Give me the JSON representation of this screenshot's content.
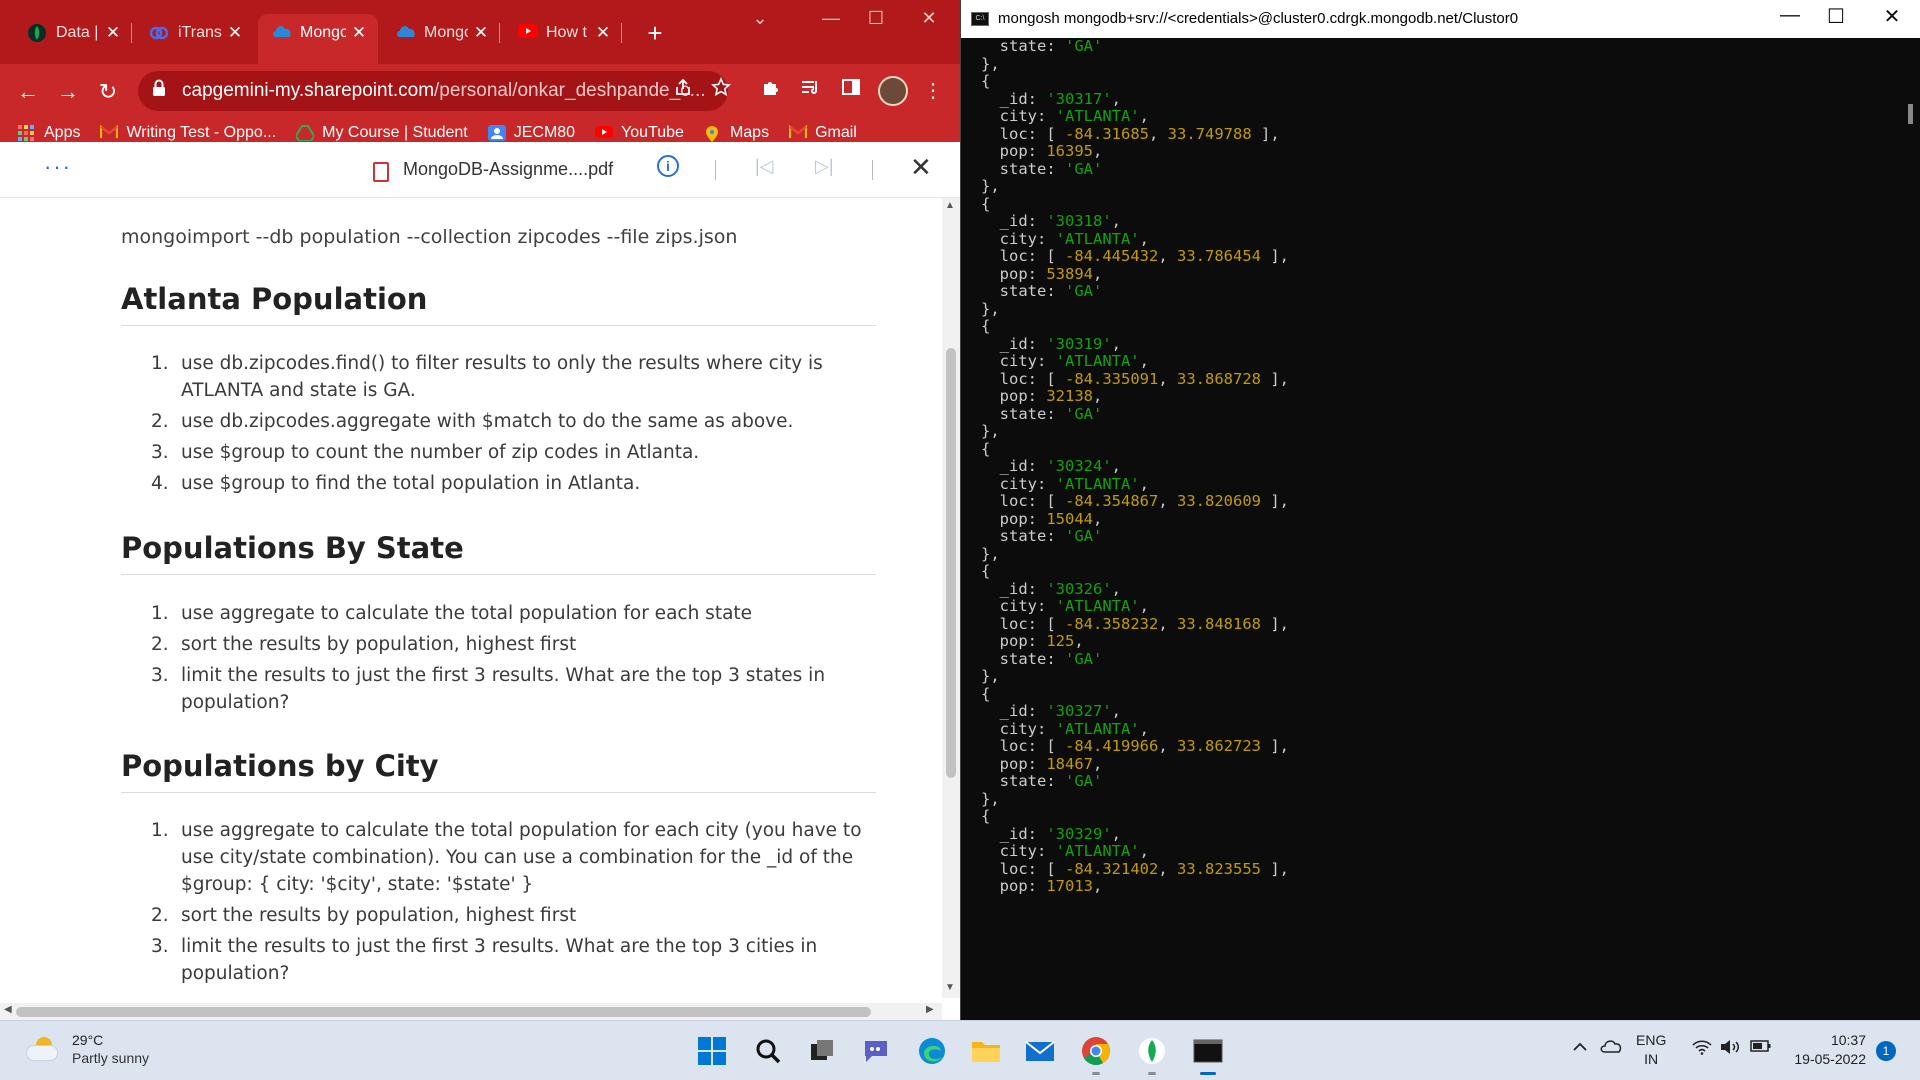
{
  "browser": {
    "tabs": [
      {
        "label": "Data |",
        "favicon_color": "#116149"
      },
      {
        "label": "iTransf",
        "favicon_color": "#3a5dd6"
      },
      {
        "label": "Mongo",
        "favicon_color": "#2b88d8"
      },
      {
        "label": "Mongo",
        "favicon_color": "#2b88d8"
      },
      {
        "label": "How t",
        "favicon_color": "#ff0000"
      }
    ],
    "active_tab_index": 2,
    "new_tab_label": "+",
    "window_controls": {
      "dropdown": "⌄",
      "minimize": "—",
      "maximize": "☐",
      "close": "✕"
    },
    "address": {
      "host": "capgemini-my.sharepoint.com",
      "path": "/personal/onkar_deshpande_c..."
    },
    "nav": {
      "back": "←",
      "forward": "→",
      "reload": "↻"
    },
    "bookmarks": [
      {
        "label": "Apps",
        "icon": "apps-grid-icon",
        "color": "#ffffff"
      },
      {
        "label": "Writing Test - Oppo...",
        "icon": "gmail-icon",
        "color": "#ea4335"
      },
      {
        "label": "My Course | Student",
        "icon": "drive-icon",
        "color": "#34a853"
      },
      {
        "label": "JECM80",
        "icon": "contact-icon",
        "color": "#4285f4"
      },
      {
        "label": "YouTube",
        "icon": "youtube-icon",
        "color": "#ff0000"
      },
      {
        "label": "Maps",
        "icon": "maps-icon",
        "color": "#fbbc04"
      },
      {
        "label": "Gmail",
        "icon": "gmail-icon",
        "color": "#ea4335"
      }
    ],
    "accent_color": "#c8282a"
  },
  "pdf": {
    "more_label": "···",
    "file_name": "MongoDB-Assignme....pdf",
    "info_label": "i",
    "first_page": "|◁",
    "last_page": "▷|",
    "close_label": "✕",
    "import_command": "mongoimport --db population --collection zipcodes --file zips.json",
    "sections": [
      {
        "title": "Atlanta Population",
        "items": [
          "use db.zipcodes.find() to filter results to only the results where city is ATLANTA and state is GA.",
          "use db.zipcodes.aggregate with $match to do the same as above.",
          "use $group to count the number of zip codes in Atlanta.",
          "use $group to find the total population in Atlanta."
        ]
      },
      {
        "title": "Populations By State",
        "items": [
          "use aggregate to calculate the total population for each state",
          "sort the results by population, highest first",
          "limit the results to just the first 3 results. What are the top 3 states in population?"
        ]
      },
      {
        "title": "Populations by City",
        "items": [
          "use aggregate to calculate the total population for each city (you have to use city/state combination). You can use a combination for the _id of the $group: { city: '$city', state: '$state' }",
          "sort the results by population, highest first",
          "limit the results to just the first 3 results. What are the top 3 cities in population?"
        ]
      }
    ]
  },
  "terminal": {
    "title": "mongosh mongodb+srv://<credentials>@cluster0.cdrgk.mongodb.net/Clustor0",
    "controls": {
      "minimize": "—",
      "maximize": "☐",
      "close": "✕"
    },
    "leading_state": "GA",
    "records": [
      {
        "_id": "30317",
        "city": "ATLANTA",
        "loc": [
          "-84.31685",
          "33.749788"
        ],
        "pop": "16395",
        "state": "GA"
      },
      {
        "_id": "30318",
        "city": "ATLANTA",
        "loc": [
          "-84.445432",
          "33.786454"
        ],
        "pop": "53894",
        "state": "GA"
      },
      {
        "_id": "30319",
        "city": "ATLANTA",
        "loc": [
          "-84.335091",
          "33.868728"
        ],
        "pop": "32138",
        "state": "GA"
      },
      {
        "_id": "30324",
        "city": "ATLANTA",
        "loc": [
          "-84.354867",
          "33.820609"
        ],
        "pop": "15044",
        "state": "GA"
      },
      {
        "_id": "30326",
        "city": "ATLANTA",
        "loc": [
          "-84.358232",
          "33.848168"
        ],
        "pop": "125",
        "state": "GA"
      },
      {
        "_id": "30327",
        "city": "ATLANTA",
        "loc": [
          "-84.419966",
          "33.862723"
        ],
        "pop": "18467",
        "state": "GA"
      },
      {
        "_id": "30329",
        "city": "ATLANTA",
        "loc": [
          "-84.321402",
          "33.823555"
        ],
        "pop": "17013",
        "state": ""
      }
    ]
  },
  "taskbar": {
    "weather": {
      "temp": "29°C",
      "desc": "Partly sunny"
    },
    "apps": [
      {
        "name": "start-button",
        "icon": "windows-icon"
      },
      {
        "name": "search-button",
        "icon": "search-icon"
      },
      {
        "name": "task-view-button",
        "icon": "task-view-icon"
      },
      {
        "name": "teams-chat-button",
        "icon": "chat-icon"
      },
      {
        "name": "edge-button",
        "icon": "edge-icon"
      },
      {
        "name": "file-explorer-button",
        "icon": "folder-icon"
      },
      {
        "name": "mail-button",
        "icon": "mail-icon"
      },
      {
        "name": "chrome-button",
        "icon": "chrome-icon"
      },
      {
        "name": "mongodb-compass-button",
        "icon": "mongodb-leaf-icon"
      },
      {
        "name": "terminal-button",
        "icon": "terminal-icon"
      }
    ],
    "language": {
      "line1": "ENG",
      "line2": "IN"
    },
    "clock": {
      "time": "10:37",
      "date": "19-05-2022"
    },
    "notification_count": "1"
  }
}
